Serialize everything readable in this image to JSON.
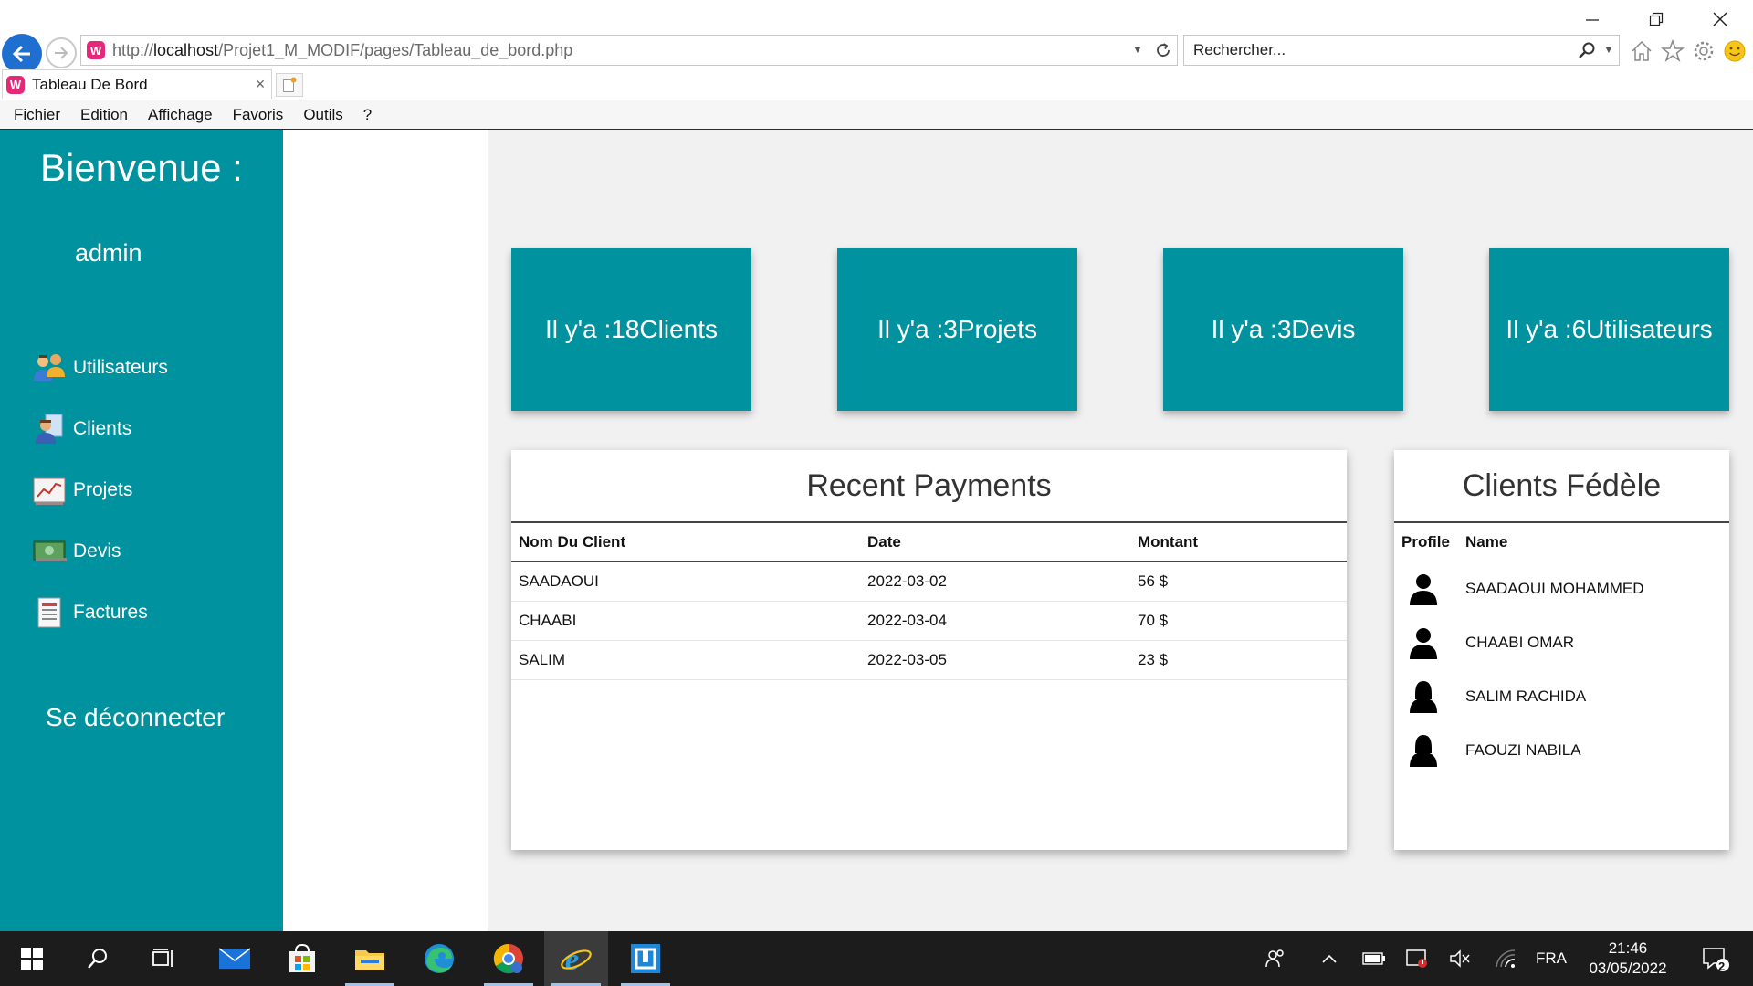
{
  "browser": {
    "url_prefix": "http://",
    "url_host": "localhost",
    "url_path": "/Projet1_M_MODIF/pages/Tableau_de_bord.php",
    "search_placeholder": "Rechercher...",
    "tab_title": "Tableau De Bord",
    "favicon_glyph": "W",
    "menu": [
      "Fichier",
      "Edition",
      "Affichage",
      "Favoris",
      "Outils",
      "?"
    ]
  },
  "sidebar": {
    "welcome": "Bienvenue :",
    "username": "admin",
    "items": [
      {
        "label": "Utilisateurs",
        "icon": "users-icon"
      },
      {
        "label": "Clients",
        "icon": "client-icon"
      },
      {
        "label": "Projets",
        "icon": "chart-icon"
      },
      {
        "label": "Devis",
        "icon": "money-icon"
      },
      {
        "label": "Factures",
        "icon": "invoice-icon"
      }
    ],
    "logout": "Se déconnecter"
  },
  "stats": [
    {
      "text": "Il y'a :18Clients"
    },
    {
      "text": "Il y'a :3Projets"
    },
    {
      "text": "Il y'a :3Devis"
    },
    {
      "text": "Il y'a :6Utilisateurs"
    }
  ],
  "payments": {
    "title": "Recent Payments",
    "headers": [
      "Nom Du Client",
      "Date",
      "Montant"
    ],
    "rows": [
      [
        "SAADAOUI",
        "2022-03-02",
        "56 $"
      ],
      [
        "CHAABI",
        "2022-03-04",
        "70 $"
      ],
      [
        "SALIM",
        "2022-03-05",
        "23 $"
      ]
    ]
  },
  "clients": {
    "title": "Clients Fédèle",
    "headers": [
      "Profile",
      "Name"
    ],
    "rows": [
      "SAADAOUI MOHAMMED",
      "CHAABI OMAR",
      "SALIM RACHIDA",
      "FAOUZI NABILA"
    ]
  },
  "taskbar": {
    "lang": "FRA",
    "time": "21:46",
    "date": "03/05/2022",
    "notifications": "2"
  },
  "colors": {
    "accent": "#00929f",
    "main_bg": "#f1f1f1"
  }
}
